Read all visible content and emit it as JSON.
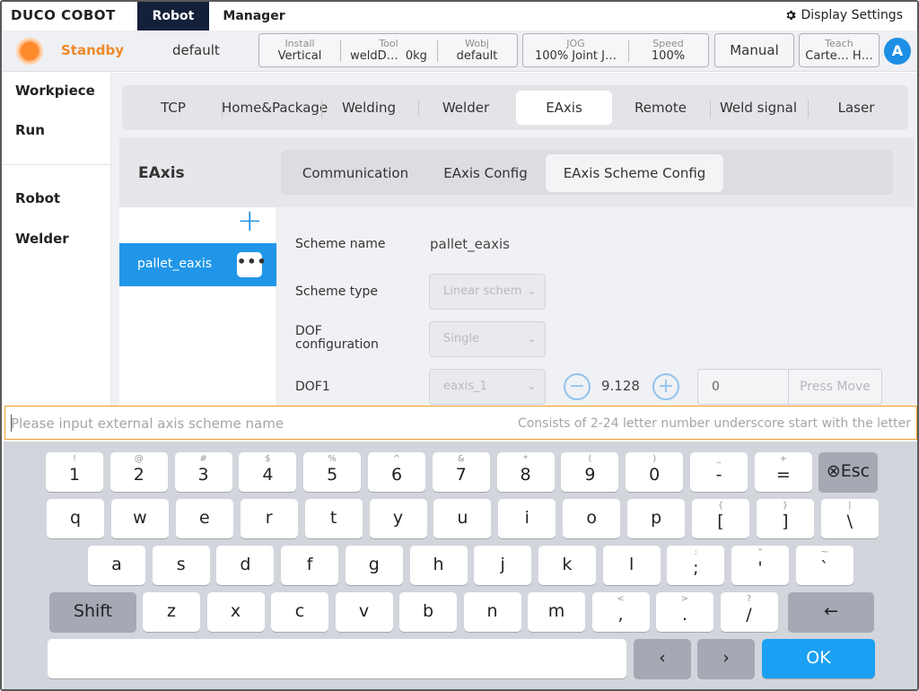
{
  "brand": "DUCO COBOT",
  "nav": {
    "tabs": [
      "Robot",
      "Manager"
    ],
    "active": "Robot",
    "display_settings": "Display Settings"
  },
  "status": {
    "state": "Standby",
    "program": "default",
    "install": {
      "label": "Install",
      "value": "Vertical"
    },
    "tool": {
      "label": "Tool",
      "value": "weldD…",
      "load": "0kg"
    },
    "wobj": {
      "label": "Wobj",
      "value": "default"
    },
    "jog": {
      "label": "JOG",
      "value": "100% Joint J…"
    },
    "speed": {
      "label": "Speed",
      "value": "100%"
    },
    "mode": "Manual",
    "teach": {
      "label": "Teach",
      "value": "Carte…  H…"
    },
    "avatar_letter": "A"
  },
  "sidebar": {
    "items": [
      "Workpiece",
      "Run",
      "Robot",
      "Welder"
    ]
  },
  "tabs": [
    "TCP",
    "Home&Package",
    "Welding",
    "Welder",
    "EAxis",
    "Remote",
    "Weld signal",
    "Laser"
  ],
  "active_tab": "EAxis",
  "panel": {
    "title": "EAxis",
    "subtabs": [
      "Communication",
      "EAxis Config",
      "EAxis Scheme Config"
    ],
    "active_subtab": "EAxis Scheme Config",
    "add_symbol": "+",
    "schemes": [
      "pallet_eaxis"
    ],
    "more_symbol": "•••"
  },
  "form": {
    "scheme_name_label": "Scheme name",
    "scheme_name_value": "pallet_eaxis",
    "scheme_type_label": "Scheme type",
    "scheme_type_value": "Linear schem",
    "dof_config_label_1": "DOF",
    "dof_config_label_2": "configuration",
    "dof_config_value": "Single",
    "dof1_label": "DOF1",
    "dof1_axis": "eaxis_1",
    "dof1_value": "9.128",
    "move_target": "0",
    "press_move": "Press Move",
    "minus": "−",
    "plus": "+"
  },
  "input": {
    "placeholder": "Please input external axis scheme name",
    "hint": "Consists of 2-24 letter number underscore start with the letter"
  },
  "keyboard": {
    "row1": [
      [
        "!",
        "1"
      ],
      [
        "@",
        "2"
      ],
      [
        "#",
        "3"
      ],
      [
        "$",
        "4"
      ],
      [
        "%",
        "5"
      ],
      [
        "^",
        "6"
      ],
      [
        "&",
        "7"
      ],
      [
        "*",
        "8"
      ],
      [
        "(",
        "9"
      ],
      [
        ")",
        "0"
      ],
      [
        "_",
        "-"
      ],
      [
        "+",
        "="
      ]
    ],
    "esc": "⊗Esc",
    "row2": [
      [
        "",
        "q"
      ],
      [
        "",
        "w"
      ],
      [
        "",
        "e"
      ],
      [
        "",
        "r"
      ],
      [
        "",
        "t"
      ],
      [
        "",
        "y"
      ],
      [
        "",
        "u"
      ],
      [
        "",
        "i"
      ],
      [
        "",
        "o"
      ],
      [
        "",
        "p"
      ],
      [
        "{",
        "["
      ],
      [
        "}",
        "]"
      ],
      [
        "|",
        "\\"
      ]
    ],
    "row3": [
      [
        "",
        "a"
      ],
      [
        "",
        "s"
      ],
      [
        "",
        "d"
      ],
      [
        "",
        "f"
      ],
      [
        "",
        "g"
      ],
      [
        "",
        "h"
      ],
      [
        "",
        "j"
      ],
      [
        "",
        "k"
      ],
      [
        "",
        "l"
      ],
      [
        ":",
        ";"
      ],
      [
        "\"",
        "'"
      ],
      [
        "~",
        "`"
      ]
    ],
    "shift": "Shift",
    "row4": [
      [
        "",
        "z"
      ],
      [
        "",
        "x"
      ],
      [
        "",
        "c"
      ],
      [
        "",
        "v"
      ],
      [
        "",
        "b"
      ],
      [
        "",
        "n"
      ],
      [
        "",
        "m"
      ],
      [
        "<",
        ","
      ],
      [
        ">",
        "."
      ],
      [
        "?",
        "/"
      ]
    ],
    "backspace": "←",
    "left": "‹",
    "right": "›",
    "ok": "OK"
  },
  "colors": {
    "accent": "#1c8fe5",
    "standby": "#ee8a2a",
    "nav_active": "#14203a",
    "input_border": "#ee9f2c"
  }
}
